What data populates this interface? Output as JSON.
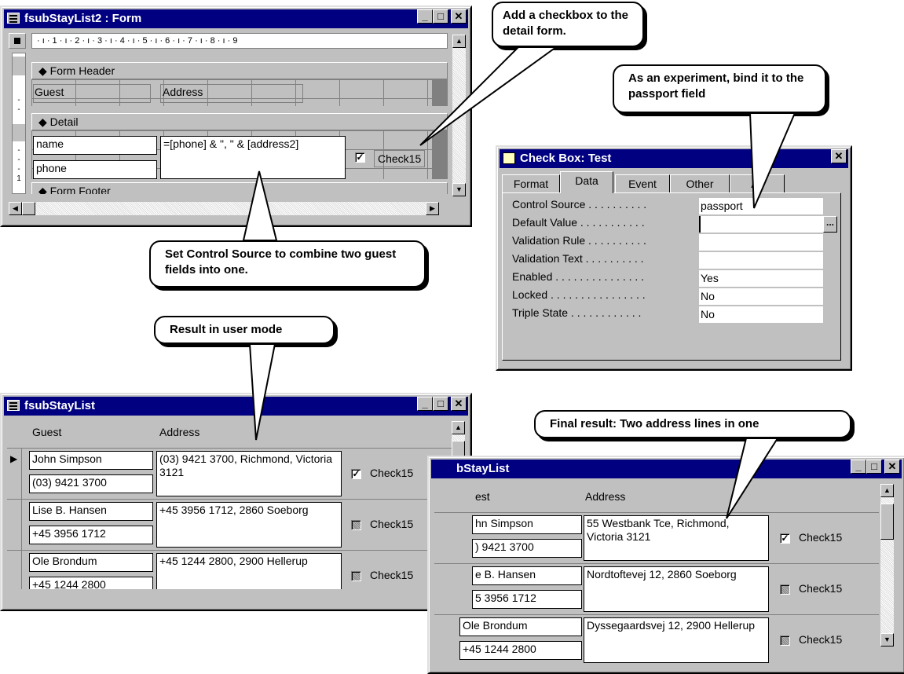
{
  "design_window": {
    "title": "fsubStayList2 : Form",
    "ruler_text": "· ı · 1 · ı · 2 · ı · 3 · ı · 4 · ı · 5 · ı · 6 · ı · 7 · ı · 8 · ı · 9",
    "form_header_label": "Form Header",
    "header_guest": "Guest",
    "header_address": "Address",
    "detail_label": "Detail",
    "field_name": "name",
    "field_phone": "phone",
    "field_address_expr": "=[phone] & \", \" & [address2]",
    "checkbox_label": "Check15",
    "form_footer_label": "Form Footer"
  },
  "callouts": {
    "add_checkbox": "Add a checkbox to the detail form.",
    "experiment": "As an experiment, bind it to the passport field",
    "control_source": "Set Control Source to combine two guest  fields into one.",
    "user_mode": "Result in user mode",
    "final_result": "Final result: Two address lines in one"
  },
  "property_window": {
    "title": "Check Box: Test",
    "tabs": [
      "Format",
      "Data",
      "Event",
      "Other",
      "All"
    ],
    "properties": [
      {
        "label": "Control Source . . . . . . . . . .",
        "value": "passport"
      },
      {
        "label": "Default Value . . . . . . . . . . .",
        "value": ""
      },
      {
        "label": "Validation Rule . . . . . . . . . .",
        "value": ""
      },
      {
        "label": "Validation Text . . . . . . . . . .",
        "value": ""
      },
      {
        "label": "Enabled . . . . . . . . . . . . . . .",
        "value": "Yes"
      },
      {
        "label": "Locked . . . . . . . . . . . . . . . .",
        "value": "No"
      },
      {
        "label": "Triple State . . . . . . . . . . . .",
        "value": "No"
      }
    ],
    "builder_button": "..."
  },
  "user_window": {
    "title": "fsubStayList",
    "col_guest": "Guest",
    "col_address": "Address",
    "rows": [
      {
        "name": "John Simpson",
        "phone": "(03) 9421 3700",
        "address": "(03) 9421 3700, Richmond, Victoria 3121",
        "check": "Check15",
        "state": "checked"
      },
      {
        "name": "Lise B. Hansen",
        "phone": "+45 3956 1712",
        "address": "+45 3956 1712, 2860 Soeborg",
        "check": "Check15",
        "state": "grey"
      },
      {
        "name": "Ole Brondum",
        "phone": "+45 1244 2800",
        "address": "+45 1244 2800, 2900 Hellerup",
        "check": "Check15",
        "state": "grey"
      }
    ]
  },
  "final_window": {
    "title": "bStayList",
    "col_guest": "est",
    "col_address": "Address",
    "rows": [
      {
        "name": "hn Simpson",
        "phone": ") 9421 3700",
        "address": "55 Westbank Tce, Richmond, Victoria 3121",
        "check": "Check15",
        "state": "checked"
      },
      {
        "name": "e B. Hansen",
        "phone": "5 3956 1712",
        "address": "Nordtoftevej 12, 2860 Soeborg",
        "check": "Check15",
        "state": "grey"
      },
      {
        "name": "Ole Brondum",
        "phone": "+45 1244 2800",
        "address": "Dyssegaardsvej 12, 2900 Hellerup",
        "check": "Check15",
        "state": "grey"
      }
    ]
  },
  "icons": {
    "minimize": "minimize-icon",
    "maximize": "maximize-icon",
    "close": "close-icon",
    "checked": "✓"
  }
}
